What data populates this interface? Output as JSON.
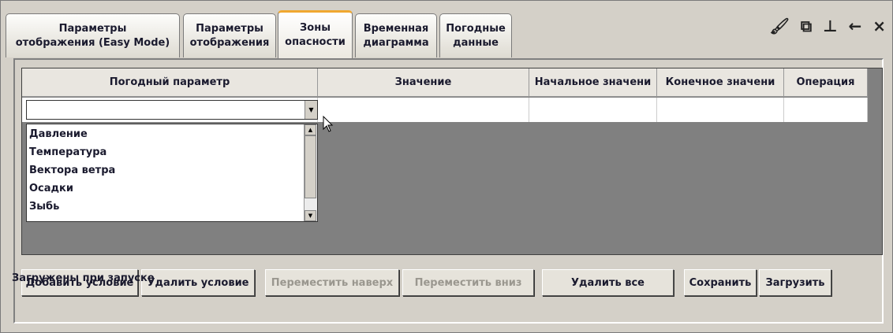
{
  "tabs": [
    {
      "label": "Параметры\nотображения (Easy Mode)"
    },
    {
      "label": "Параметры\nотображения"
    },
    {
      "label": "Зоны\nопасности",
      "active": true
    },
    {
      "label": "Временная\nдиаграмма"
    },
    {
      "label": "Погодные\nданные"
    }
  ],
  "toolbar": {
    "brush": "🖌",
    "restore": "⧉",
    "pin": "⊥",
    "back": "←",
    "close": "×"
  },
  "table": {
    "headers": [
      "Погодный параметр",
      "Значение",
      "Начальное значени",
      "Конечное значени",
      "Операция"
    ]
  },
  "dropdown": {
    "options": [
      "Давление",
      "Температура",
      "Вектора ветра",
      "Осадки",
      "Зыбь"
    ]
  },
  "buttons": {
    "add": "Добавить условие",
    "remove": "Удалить условие",
    "up": "Переместить наверх",
    "down": "Переместить вниз",
    "delete_all": "Удалить все",
    "save": "Сохранить",
    "load": "Загрузить"
  },
  "status": "Загружены при запуске"
}
